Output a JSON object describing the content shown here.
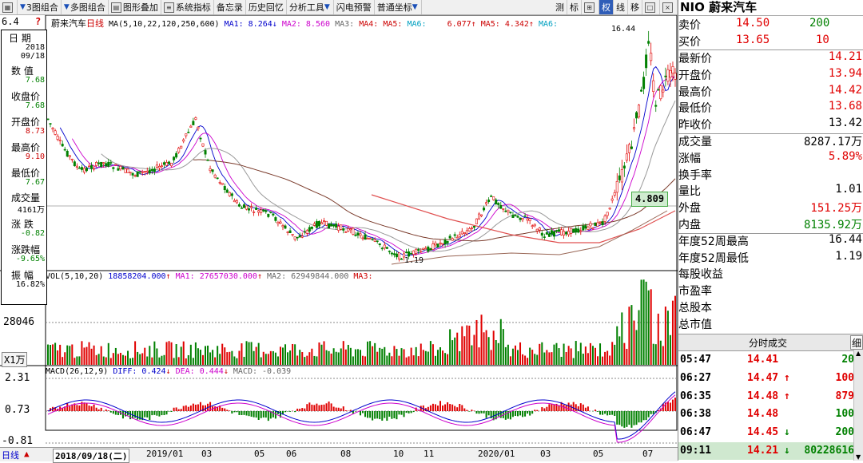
{
  "toolbar": {
    "items": [
      "3图组合",
      "多图组合",
      "图形叠加",
      "系统指标",
      "备忘录",
      "历史回忆",
      "分析工具",
      "闪电预警",
      "普通坐标",
      "测",
      "标",
      "权",
      "线",
      "移"
    ]
  },
  "chart": {
    "name": "蔚来汽车",
    "period": "日线",
    "ma_legend": {
      "params": "MA(5,10,22,120,250,600)",
      "ma1": "MA1: 8.264↓",
      "ma2": "MA2: 8.560",
      "ma3": "MA3:",
      "ma4": "MA4:",
      "ma5a": "MA5:",
      "ma6a": "MA6:",
      "v1": "6.077↑",
      "ma5b": "MA5: 4.342↑",
      "ma6b": "MA6:"
    },
    "high_label": "16.44",
    "low_label": "1.19",
    "price_tag": "4.809",
    "vol_legend": {
      "params": "VOL(5,10,20)",
      "v": "18858204.000",
      "ma1": "MA1: 27657030.000",
      "ma2": "MA2: 62949844.000",
      "ma3": "MA3:"
    },
    "vol_axis": "28046",
    "vol_unit": "X1万",
    "macd_legend": {
      "params": "MACD(26,12,9)",
      "diff": "DIFF: 0.424",
      "dea": "DEA: 0.444",
      "macd": "MACD: -0.039"
    },
    "macd_axis": [
      "2.31",
      "0.73",
      "-0.81"
    ],
    "left_top_values": [
      "6.4",
      "2"
    ],
    "date_labels": [
      "2018/09/18(二)",
      "2019/01",
      "03",
      "05",
      "06",
      "08",
      "10",
      "11",
      "2020/01",
      "03",
      "05",
      "07"
    ],
    "period_button": "日线"
  },
  "info_panel": {
    "date_label": "日 期",
    "date_year": "2018",
    "date_md": "09/18",
    "items": [
      {
        "label": "数 值",
        "value": "7.68"
      },
      {
        "label": "收盘价",
        "value": "7.68"
      },
      {
        "label": "开盘价",
        "value": "8.73"
      },
      {
        "label": "最高价",
        "value": "9.10"
      },
      {
        "label": "最低价",
        "value": "7.67"
      },
      {
        "label": "成交量",
        "value": "4161万"
      },
      {
        "label": "涨 跌",
        "value": "-0.82"
      },
      {
        "label": "涨跌幅",
        "value": "-9.65%"
      },
      {
        "label": "振 幅",
        "value": "16.82%"
      }
    ]
  },
  "quote": {
    "title": "NIO 蔚来汽车",
    "sell": {
      "label": "卖价",
      "price": "14.50",
      "qty": "200"
    },
    "buy": {
      "label": "买价",
      "price": "13.65",
      "qty": "10"
    },
    "rows": [
      {
        "label": "最新价",
        "value": "14.21",
        "color": "red"
      },
      {
        "label": "开盘价",
        "value": "13.94",
        "color": "red"
      },
      {
        "label": "最高价",
        "value": "14.42",
        "color": "red"
      },
      {
        "label": "最低价",
        "value": "13.68",
        "color": "red"
      },
      {
        "label": "昨收价",
        "value": "13.42",
        "color": "blk"
      },
      {
        "label": "成交量",
        "value": "8287.17万",
        "color": "blk"
      },
      {
        "label": "涨幅",
        "value": "5.89%",
        "color": "red"
      },
      {
        "label": "换手率",
        "value": "",
        "color": "blk"
      },
      {
        "label": "量比",
        "value": "1.01",
        "color": "blk"
      },
      {
        "label": "外盘",
        "value": "151.25万",
        "color": "red"
      },
      {
        "label": "内盘",
        "value": "8135.92万",
        "color": "grn"
      },
      {
        "label": "年度52周最高",
        "value": "16.44",
        "color": "blk"
      },
      {
        "label": "年度52周最低",
        "value": "1.19",
        "color": "blk"
      },
      {
        "label": "每股收益",
        "value": "",
        "color": "blk"
      },
      {
        "label": "市盈率",
        "value": "",
        "color": "blk"
      },
      {
        "label": "总股本",
        "value": "",
        "color": "blk"
      },
      {
        "label": "总市值",
        "value": "",
        "color": "blk"
      }
    ],
    "ticks_header": "分时成交",
    "ticks_btn": "细",
    "ticks": [
      {
        "time": "05:47",
        "price": "14.41",
        "arrow": "",
        "vol": "20",
        "vcolor": "grn"
      },
      {
        "time": "06:27",
        "price": "14.47",
        "arrow": "↑",
        "vol": "100",
        "vcolor": "red"
      },
      {
        "time": "06:35",
        "price": "14.48",
        "arrow": "↑",
        "vol": "879",
        "vcolor": "red"
      },
      {
        "time": "06:38",
        "price": "14.48",
        "arrow": "",
        "vol": "100",
        "vcolor": "grn"
      },
      {
        "time": "06:47",
        "price": "14.45",
        "arrow": "↓",
        "vol": "200",
        "vcolor": "grn"
      },
      {
        "time": "09:11",
        "price": "14.21",
        "arrow": "↓",
        "vol": "80228616",
        "vcolor": "grn"
      }
    ]
  }
}
